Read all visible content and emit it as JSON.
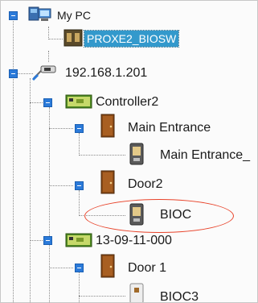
{
  "tree": {
    "my_pc": "My PC",
    "device_selected": "PROXE2_BIOSW",
    "ip": "192.168.1.201",
    "controller2": "Controller2",
    "main_entrance": "Main Entrance",
    "main_entrance_reader": "Main Entrance_",
    "door2": "Door2",
    "bioc": "BIOC",
    "controller_2": "13-09-11-000",
    "door1": "Door 1",
    "bioc3": "BIOC3"
  },
  "colors": {
    "selection": "#3399cc",
    "expander": "#2b7ad9",
    "highlight_ellipse": "#e8432a"
  }
}
